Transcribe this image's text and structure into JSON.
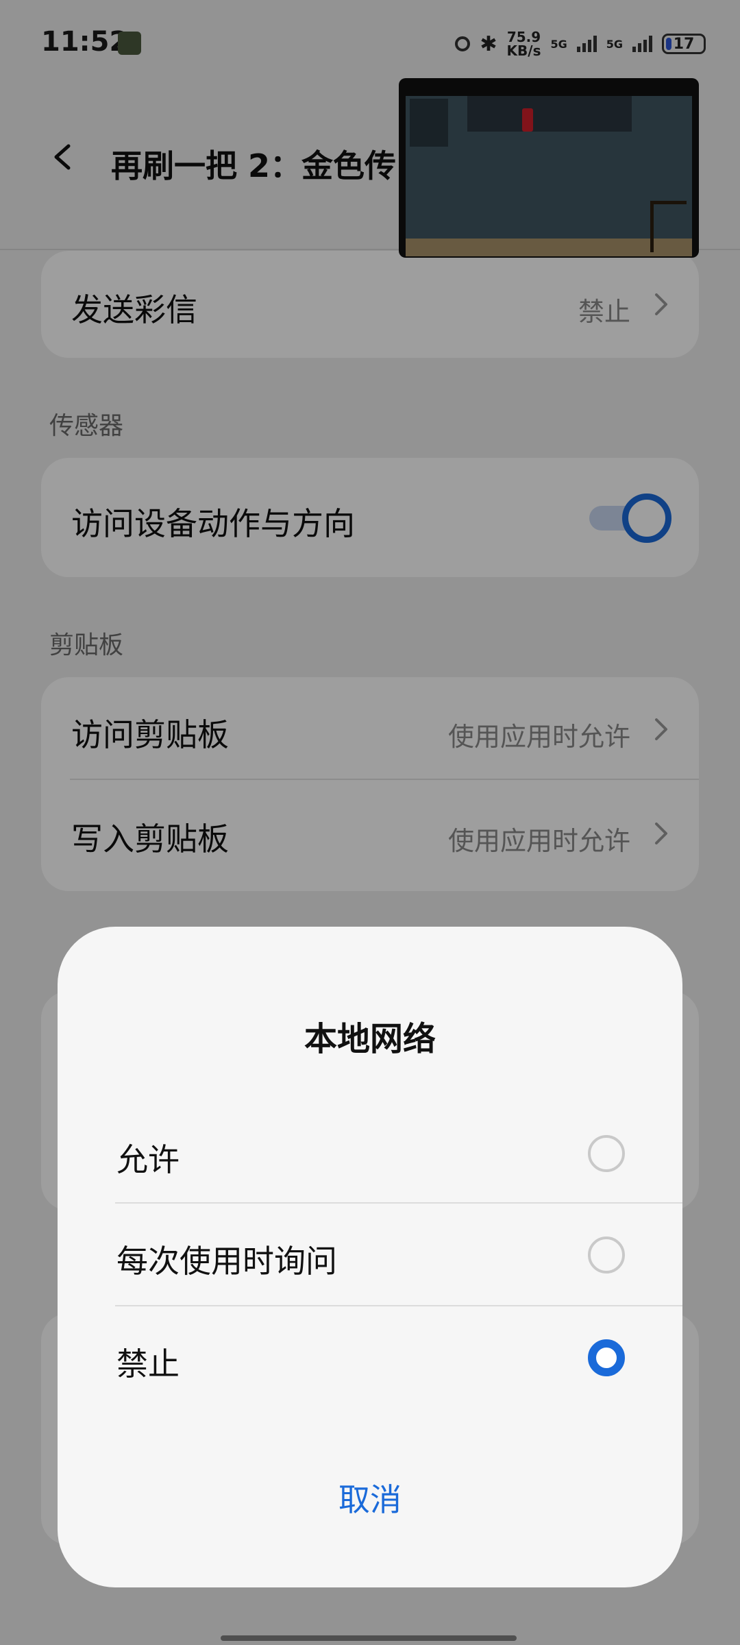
{
  "status_bar": {
    "time": "11:52",
    "speed_value": "75.9",
    "speed_unit": "KB/s",
    "network1": "5G",
    "network2": "5G",
    "battery": "17"
  },
  "header": {
    "title": "再刷一把 2：金色传"
  },
  "rows": {
    "mms": {
      "label": "发送彩信",
      "value": "禁止"
    },
    "sensor_section": "传感器",
    "motion": {
      "label": "访问设备动作与方向",
      "enabled": true
    },
    "clipboard_section": "剪贴板",
    "clip_read": {
      "label": "访问剪贴板",
      "value": "使用应用时允许"
    },
    "clip_write": {
      "label": "写入剪贴板",
      "value": "使用应用时允许"
    }
  },
  "dialog": {
    "title": "本地网络",
    "options": [
      {
        "label": "允许",
        "selected": false
      },
      {
        "label": "每次使用时询问",
        "selected": false
      },
      {
        "label": "禁止",
        "selected": true
      }
    ],
    "cancel_label": "取消"
  },
  "colors": {
    "accent": "#1a6ad9",
    "background": "#ededed",
    "card": "#ffffff"
  }
}
